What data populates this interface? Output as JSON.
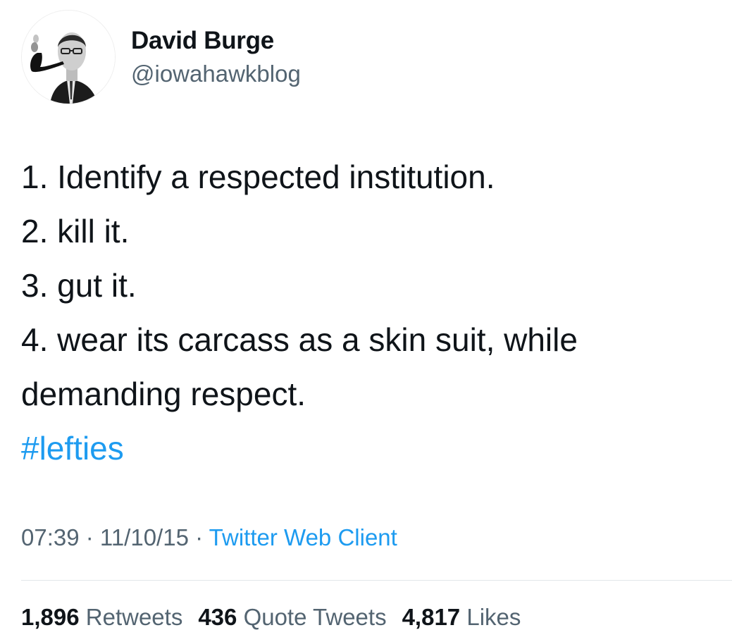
{
  "author": {
    "display_name": "David Burge",
    "handle": "@iowahawkblog"
  },
  "tweet": {
    "lines": [
      "1. Identify a respected institution.",
      "2. kill it.",
      "3. gut it.",
      "4. wear its carcass as a skin suit, while",
      "demanding respect."
    ],
    "hashtag": "#lefties"
  },
  "meta": {
    "time": "07:39",
    "separator": " · ",
    "date": "11/10/15",
    "source": "Twitter Web Client"
  },
  "stats": {
    "retweets": {
      "count": "1,896",
      "label": "Retweets"
    },
    "quote_tweets": {
      "count": "436",
      "label": "Quote Tweets"
    },
    "likes": {
      "count": "4,817",
      "label": "Likes"
    }
  },
  "colors": {
    "link": "#1d9bf0",
    "secondary_text": "#536471",
    "primary_text": "#0f1419"
  }
}
